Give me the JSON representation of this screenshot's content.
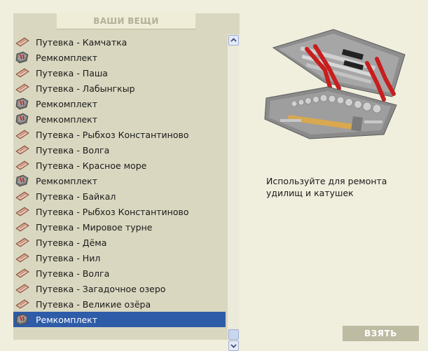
{
  "panel": {
    "title": "ВАШИ ВЕЩИ"
  },
  "items": [
    {
      "label": "Путевка - Камчатка",
      "icon": "voucher-icon"
    },
    {
      "label": "Ремкомплект",
      "icon": "repair-kit-icon"
    },
    {
      "label": "Путевка - Паша",
      "icon": "voucher-icon"
    },
    {
      "label": "Путевка - Лабынгкыр",
      "icon": "voucher-icon"
    },
    {
      "label": "Ремкомплект",
      "icon": "repair-kit-icon"
    },
    {
      "label": "Ремкомплект",
      "icon": "repair-kit-icon"
    },
    {
      "label": "Путевка - Рыбхоз Константиново",
      "icon": "voucher-icon"
    },
    {
      "label": "Путевка - Волга",
      "icon": "voucher-icon"
    },
    {
      "label": "Путевка - Красное море",
      "icon": "voucher-icon"
    },
    {
      "label": "Ремкомплект",
      "icon": "repair-kit-icon"
    },
    {
      "label": "Путевка - Байкал",
      "icon": "voucher-icon"
    },
    {
      "label": "Путевка - Рыбхоз Константиново",
      "icon": "voucher-icon"
    },
    {
      "label": "Путевка - Мировое турне",
      "icon": "voucher-icon"
    },
    {
      "label": "Путевка - Дёма",
      "icon": "voucher-icon"
    },
    {
      "label": "Путевка - Нил",
      "icon": "voucher-icon"
    },
    {
      "label": "Путевка - Волга",
      "icon": "voucher-icon"
    },
    {
      "label": "Путевка - Загадочное озеро",
      "icon": "voucher-icon"
    },
    {
      "label": "Путевка - Великие озёра",
      "icon": "voucher-icon"
    },
    {
      "label": "Ремкомплект",
      "icon": "repair-kit-icon",
      "selected": true
    }
  ],
  "detail": {
    "image": "toolbox-image",
    "description": "Используйте для ремонта удилищ и катушек"
  },
  "actions": {
    "take_label": "ВЗЯТЬ"
  },
  "colors": {
    "background": "#f0eedd",
    "panel": "#d9d7bf",
    "selection": "#2f5ca8",
    "button": "#bebba3"
  }
}
